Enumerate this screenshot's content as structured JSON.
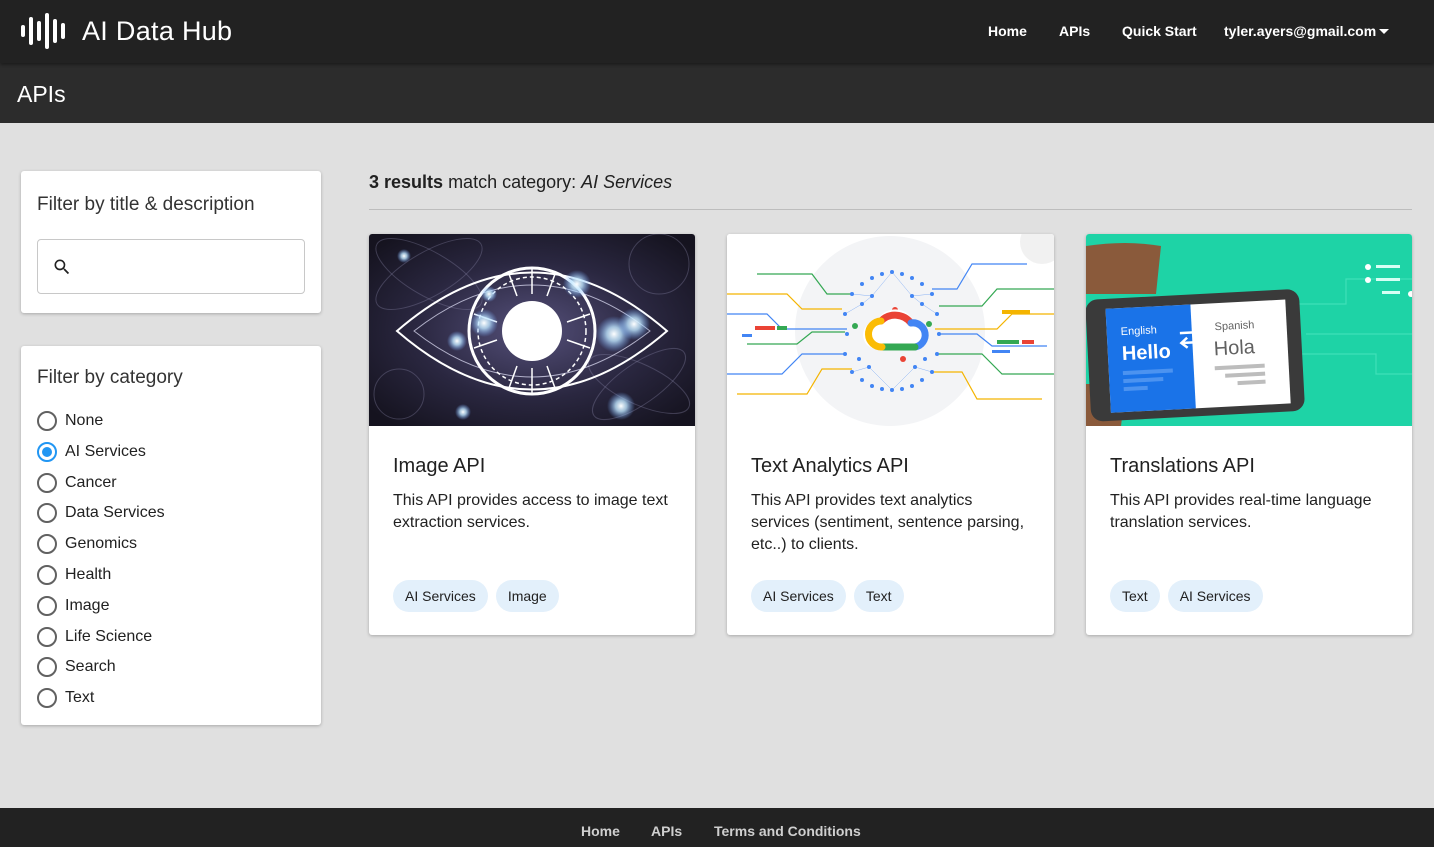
{
  "brand": {
    "name": "AI Data Hub",
    "logo_icon": "sound-bars-logo"
  },
  "nav": {
    "home": "Home",
    "apis": "APIs",
    "quick_start": "Quick Start",
    "user_email": "tyler.ayers@gmail.com"
  },
  "page": {
    "title": "APIs"
  },
  "filters": {
    "search": {
      "title": "Filter by title & description",
      "value": "",
      "icon": "search-icon"
    },
    "category": {
      "title": "Filter by category",
      "selected": "AI Services",
      "options": [
        "None",
        "AI Services",
        "Cancer",
        "Data Services",
        "Genomics",
        "Health",
        "Image",
        "Life Science",
        "Search",
        "Text"
      ]
    }
  },
  "results": {
    "count": "3 results",
    "text": "match category:",
    "category": "AI Services"
  },
  "cards": [
    {
      "title": "Image API",
      "description": "This API provides access to image text extraction services.",
      "tags": [
        "AI Services",
        "Image"
      ]
    },
    {
      "title": "Text Analytics API",
      "description": "This API provides text analytics services (sentiment, sentence parsing, etc..) to clients.",
      "tags": [
        "AI Services",
        "Text"
      ]
    },
    {
      "title": "Translations API",
      "description": "This API provides real-time language translation services.",
      "tags": [
        "Text",
        "AI Services"
      ],
      "image_text": {
        "left_lang": "English",
        "left_word": "Hello",
        "right_lang": "Spanish",
        "right_word": "Hola"
      }
    }
  ],
  "footer": {
    "home": "Home",
    "apis": "APIs",
    "terms": "Terms and Conditions"
  },
  "colors": {
    "topbar": "#222222",
    "titlebar": "#2c2c2c",
    "background": "#e0e0e0",
    "accent": "#2196f3",
    "chip": "#e3f0fb",
    "translation_bg": "#1ed3a6"
  }
}
